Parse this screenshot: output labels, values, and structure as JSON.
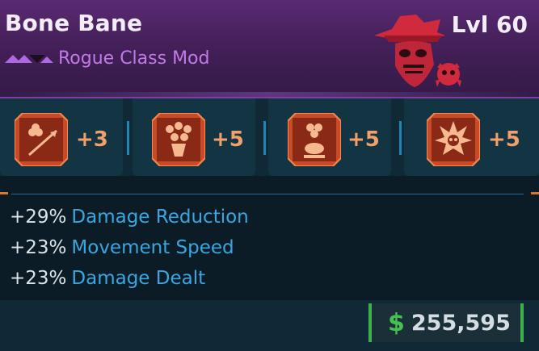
{
  "item": {
    "name": "Bone Bane",
    "level_label": "Lvl 60",
    "class_label": "Rogue Class Mod"
  },
  "skills": [
    {
      "icon": "clover-arrow-icon",
      "value": "+3"
    },
    {
      "icon": "clover-bouquet-icon",
      "value": "+5"
    },
    {
      "icon": "clover-frog-icon",
      "value": "+5"
    },
    {
      "icon": "skull-explosion-icon",
      "value": "+5"
    }
  ],
  "stats": [
    {
      "value": "+29%",
      "name": "Damage Reduction"
    },
    {
      "value": "+23%",
      "name": "Movement Speed"
    },
    {
      "value": "+23%",
      "name": "Damage Dealt"
    }
  ],
  "price": {
    "currency_symbol": "$",
    "amount": "255,595"
  },
  "colors": {
    "rarity": "#b068e0",
    "skill_value": "#f2a06a",
    "stat_name": "#3aa6e0",
    "currency": "#44c14f",
    "accent_blue": "#1f86b8",
    "accent_orange": "#d9782a"
  }
}
